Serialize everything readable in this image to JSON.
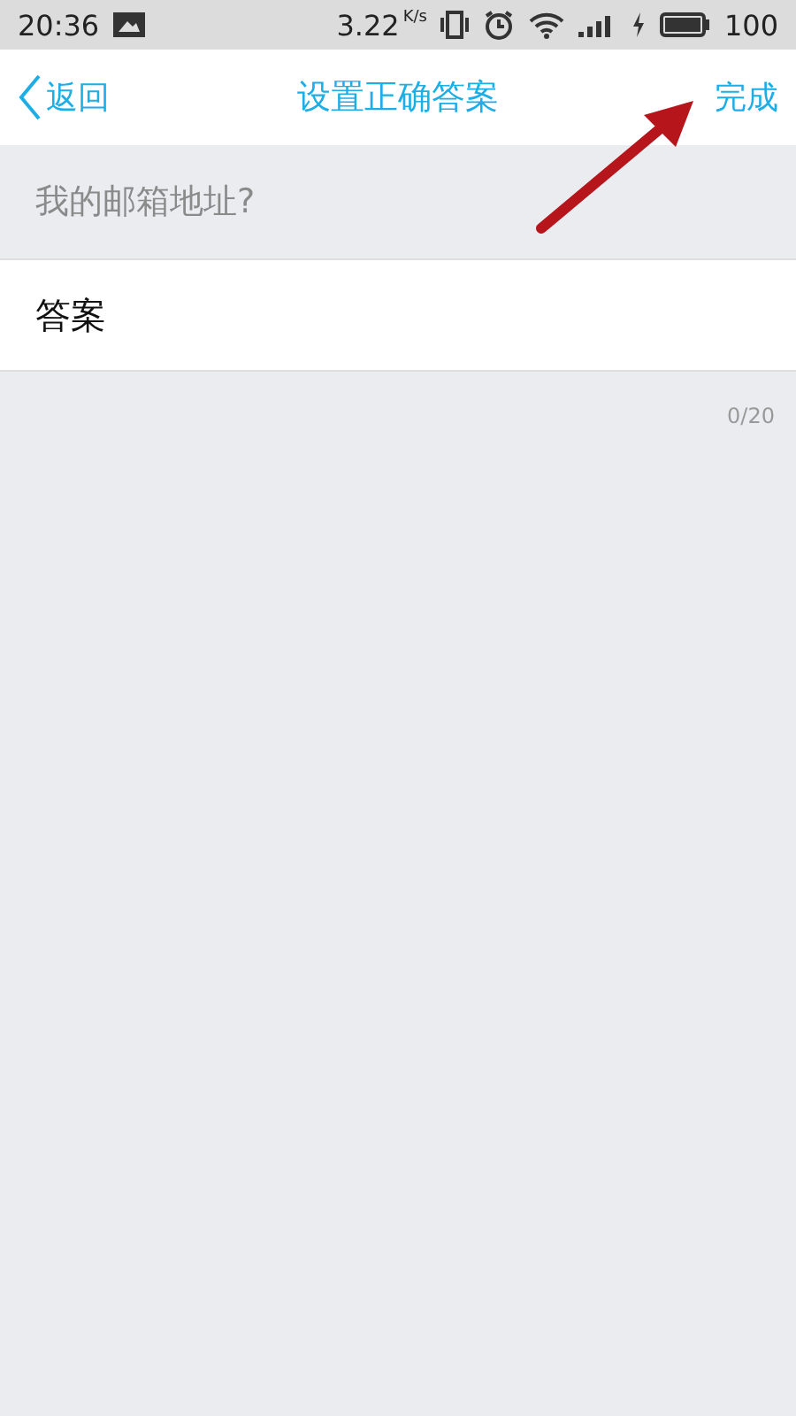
{
  "status_bar": {
    "time": "20:36",
    "speed": "3.22",
    "speed_unit": "K/s",
    "battery": "100"
  },
  "nav_bar": {
    "back": "返回",
    "title": "设置正确答案",
    "done": "完成"
  },
  "question": "我的邮箱地址?",
  "answer_field": {
    "value": "答案"
  },
  "counter": "0/20"
}
